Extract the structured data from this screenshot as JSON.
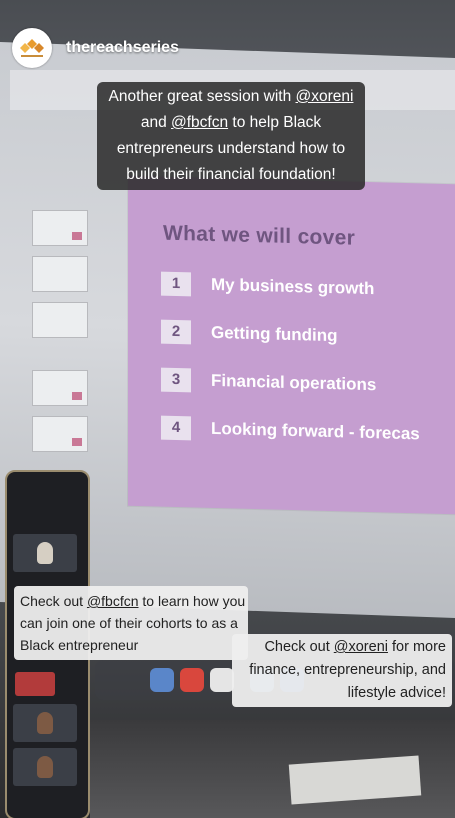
{
  "header": {
    "username": "thereachseries",
    "avatar_icon": "reach-logo"
  },
  "captions": {
    "top": {
      "lines": [
        [
          "Another great session with ",
          "@xoreni",
          ""
        ],
        [
          "and ",
          "@fbcfcn",
          " to help Black"
        ],
        [
          "entrepreneurs understand how to",
          "",
          ""
        ],
        [
          "build their financial foundation!",
          "",
          ""
        ]
      ]
    },
    "left": {
      "lines": [
        [
          "Check out ",
          "@fbcfcn",
          " to learn how you"
        ],
        [
          "can join one of their cohorts to as a",
          "",
          ""
        ],
        [
          "Black entrepreneur",
          "",
          ""
        ]
      ]
    },
    "right": {
      "lines": [
        [
          "Check out ",
          "@xoreni",
          " for more"
        ],
        [
          "finance, entrepreneurship, and",
          "",
          ""
        ],
        [
          "lifestyle advice!",
          "",
          ""
        ]
      ]
    }
  },
  "slide": {
    "title": "What we will cover",
    "items": [
      {
        "num": "1",
        "label": "My business growth"
      },
      {
        "num": "2",
        "label": "Getting funding"
      },
      {
        "num": "3",
        "label": "Financial operations"
      },
      {
        "num": "4",
        "label": "Looking forward - forecas"
      }
    ]
  },
  "colors": {
    "slide_bg": "#c59ed0",
    "slide_title": "#6f5580",
    "caption_dark": "#282828",
    "caption_light": "#eeeeee"
  }
}
